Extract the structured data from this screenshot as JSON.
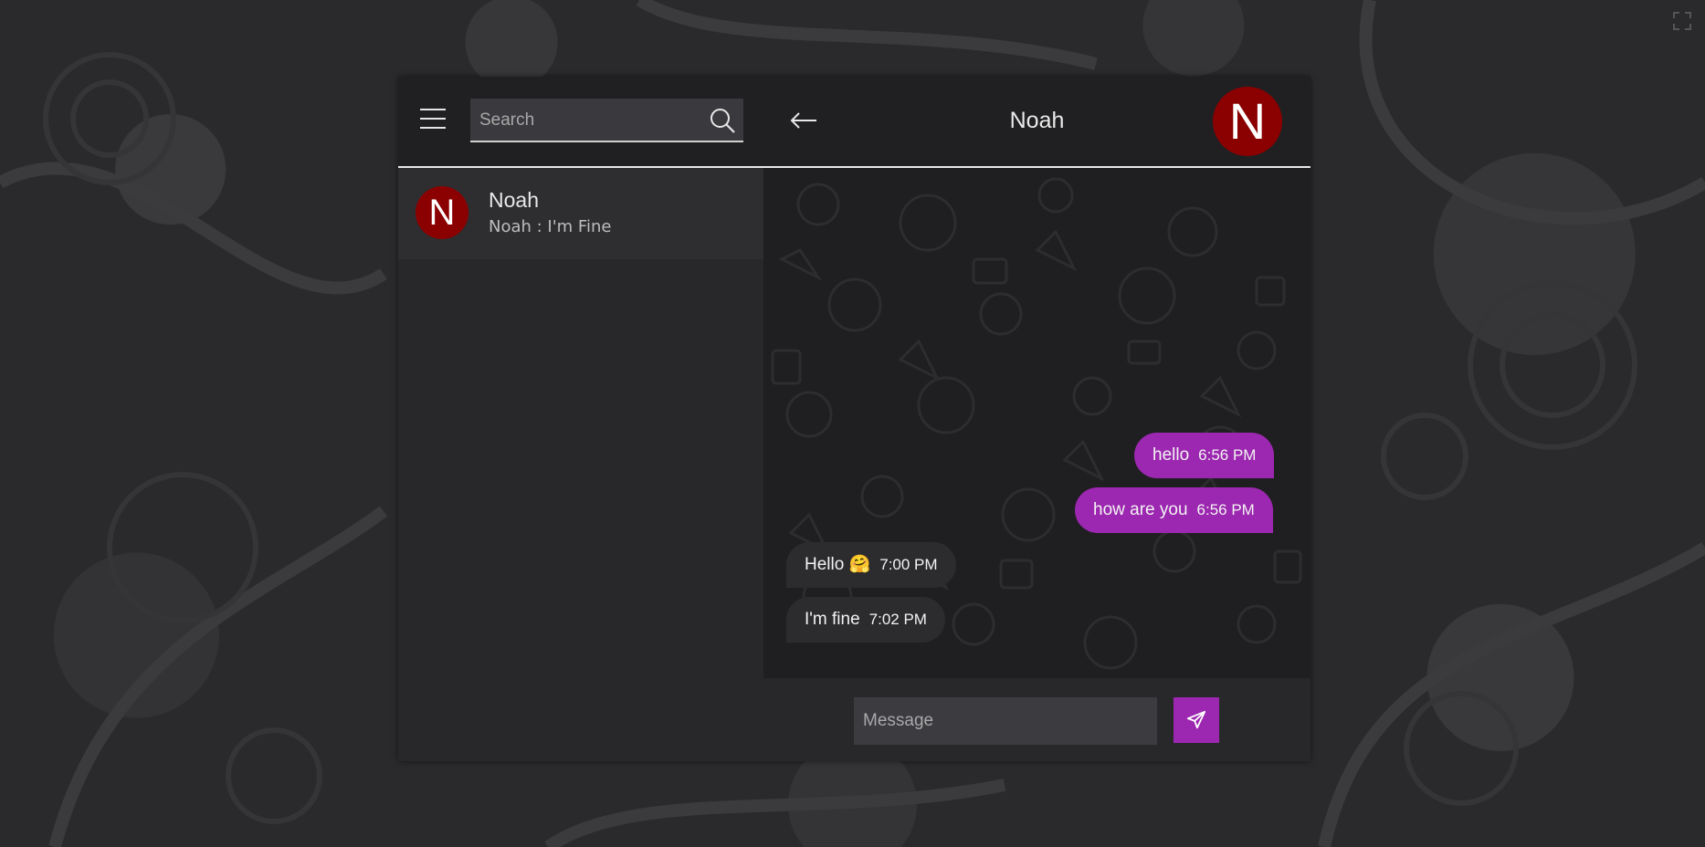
{
  "sidebar": {
    "search_placeholder": "Search",
    "contacts": [
      {
        "initial": "N",
        "name": "Noah",
        "last_message": "Noah : I'm Fine"
      }
    ]
  },
  "chat": {
    "title": "Noah",
    "avatar_initial": "N",
    "messages": [
      {
        "direction": "sent",
        "text": "hello",
        "time": "6:56 PM"
      },
      {
        "direction": "sent",
        "text": "how are you",
        "time": "6:56 PM"
      },
      {
        "direction": "received",
        "text": "Hello 🤗",
        "time": "7:00 PM"
      },
      {
        "direction": "received",
        "text": "I'm fine",
        "time": "7:02 PM"
      }
    ],
    "composer_placeholder": "Message"
  },
  "icons": {
    "menu": "hamburger-icon",
    "search": "search-icon",
    "back": "arrow-left-icon",
    "send": "paper-plane-icon",
    "corner": "expand-icon"
  },
  "colors": {
    "accent": "#9c27b0",
    "avatar": "#8b0000",
    "header": "#202022",
    "panel": "#28282b"
  }
}
